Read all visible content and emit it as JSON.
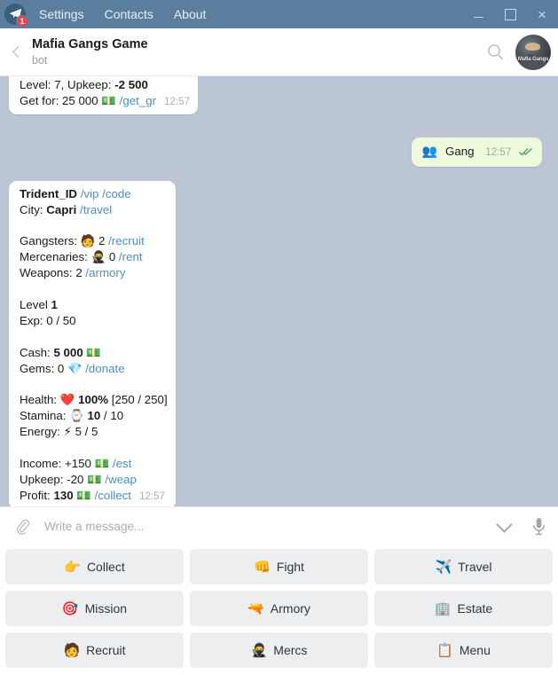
{
  "titlebar": {
    "logo_icon": "telegram-plane-icon",
    "unread_badge": "1",
    "menu": [
      {
        "label": "Settings"
      },
      {
        "label": "Contacts"
      },
      {
        "label": "About"
      }
    ],
    "window_controls": {
      "minimize": "minimize-icon",
      "maximize": "maximize-icon",
      "close": "×"
    },
    "bg_color": "#5b7e9e"
  },
  "chat_header": {
    "back_icon": "chevron-left-icon",
    "title": "Mafia Gangs Game",
    "subtitle": "bot",
    "search_icon": "search-icon",
    "avatar_text": "Mafia Gangs"
  },
  "chat": {
    "bg_color": "#bcc5d4",
    "messages": [
      {
        "id": "msg-partial-top",
        "direction": "in",
        "partial": true,
        "lines": [
          {
            "segments": [
              {
                "t": "Level: 7, Upkeep: ",
                "s": "plain"
              },
              {
                "t": "-2 500",
                "s": "bold"
              }
            ]
          },
          {
            "segments": [
              {
                "t": "Get for: 25 000 ",
                "s": "plain"
              },
              {
                "t": "💵",
                "s": "emoji"
              },
              {
                "t": " ",
                "s": "plain"
              },
              {
                "t": "/get_gr",
                "s": "cmd"
              }
            ]
          }
        ],
        "time": "12:57"
      },
      {
        "id": "msg-gang-out",
        "direction": "out",
        "text": "Gang",
        "icon": "👥",
        "time": "12:57",
        "status": "read",
        "bubble_color": "#effadd"
      },
      {
        "id": "msg-profile-in",
        "direction": "in",
        "blocks": [
          {
            "block": "identity",
            "lines": [
              {
                "segments": [
                  {
                    "t": "Trident_ID",
                    "s": "bold"
                  },
                  {
                    "t": " ",
                    "s": "plain"
                  },
                  {
                    "t": "/vip",
                    "s": "cmd"
                  },
                  {
                    "t": " ",
                    "s": "plain"
                  },
                  {
                    "t": "/code",
                    "s": "cmd"
                  }
                ]
              },
              {
                "segments": [
                  {
                    "t": "City: ",
                    "s": "plain"
                  },
                  {
                    "t": "Capri",
                    "s": "bold"
                  },
                  {
                    "t": " ",
                    "s": "plain"
                  },
                  {
                    "t": "/travel",
                    "s": "cmd"
                  }
                ]
              }
            ]
          },
          {
            "block": "units",
            "lines": [
              {
                "segments": [
                  {
                    "t": "Gangsters: ",
                    "s": "plain"
                  },
                  {
                    "t": "🧑",
                    "s": "emoji"
                  },
                  {
                    "t": " 2 ",
                    "s": "plain"
                  },
                  {
                    "t": "/recruit",
                    "s": "cmd"
                  }
                ]
              },
              {
                "segments": [
                  {
                    "t": "Mercenaries: ",
                    "s": "plain"
                  },
                  {
                    "t": "🥷",
                    "s": "emoji"
                  },
                  {
                    "t": " 0 ",
                    "s": "plain"
                  },
                  {
                    "t": "/rent",
                    "s": "cmd"
                  }
                ]
              },
              {
                "segments": [
                  {
                    "t": "Weapons: 2 ",
                    "s": "plain"
                  },
                  {
                    "t": "/armory",
                    "s": "cmd"
                  }
                ]
              }
            ]
          },
          {
            "block": "level",
            "lines": [
              {
                "segments": [
                  {
                    "t": "Level ",
                    "s": "plain"
                  },
                  {
                    "t": "1",
                    "s": "bold"
                  }
                ]
              },
              {
                "segments": [
                  {
                    "t": "Exp: 0 / 50",
                    "s": "plain"
                  }
                ]
              }
            ]
          },
          {
            "block": "currency",
            "lines": [
              {
                "segments": [
                  {
                    "t": "Cash: ",
                    "s": "plain"
                  },
                  {
                    "t": "5 000",
                    "s": "bold"
                  },
                  {
                    "t": " ",
                    "s": "plain"
                  },
                  {
                    "t": "💵",
                    "s": "emoji"
                  }
                ]
              },
              {
                "segments": [
                  {
                    "t": "Gems: 0 ",
                    "s": "plain"
                  },
                  {
                    "t": "💎",
                    "s": "emoji"
                  },
                  {
                    "t": " ",
                    "s": "plain"
                  },
                  {
                    "t": "/donate",
                    "s": "cmd"
                  }
                ]
              }
            ]
          },
          {
            "block": "vitals",
            "lines": [
              {
                "segments": [
                  {
                    "t": "Health: ",
                    "s": "plain"
                  },
                  {
                    "t": "❤️",
                    "s": "emoji"
                  },
                  {
                    "t": " ",
                    "s": "plain"
                  },
                  {
                    "t": "100%",
                    "s": "bold"
                  },
                  {
                    "t": " [250 / 250]",
                    "s": "plain"
                  }
                ]
              },
              {
                "segments": [
                  {
                    "t": "Stamina: ",
                    "s": "plain"
                  },
                  {
                    "t": "⌚",
                    "s": "emoji"
                  },
                  {
                    "t": " ",
                    "s": "plain"
                  },
                  {
                    "t": "10",
                    "s": "bold"
                  },
                  {
                    "t": " / 10",
                    "s": "plain"
                  }
                ]
              },
              {
                "segments": [
                  {
                    "t": "Energy: ",
                    "s": "plain"
                  },
                  {
                    "t": "⚡",
                    "s": "emoji"
                  },
                  {
                    "t": " 5 / 5",
                    "s": "plain"
                  }
                ]
              }
            ]
          },
          {
            "block": "economy",
            "lines": [
              {
                "segments": [
                  {
                    "t": "Income: +150 ",
                    "s": "plain"
                  },
                  {
                    "t": "💵",
                    "s": "emoji"
                  },
                  {
                    "t": " ",
                    "s": "plain"
                  },
                  {
                    "t": "/est",
                    "s": "cmd"
                  }
                ]
              },
              {
                "segments": [
                  {
                    "t": "Upkeep: -20 ",
                    "s": "plain"
                  },
                  {
                    "t": "💵",
                    "s": "emoji"
                  },
                  {
                    "t": " ",
                    "s": "plain"
                  },
                  {
                    "t": "/weap",
                    "s": "cmd"
                  }
                ]
              },
              {
                "segments": [
                  {
                    "t": "Profit: ",
                    "s": "plain"
                  },
                  {
                    "t": "130",
                    "s": "bold"
                  },
                  {
                    "t": " ",
                    "s": "plain"
                  },
                  {
                    "t": "💵",
                    "s": "emoji"
                  },
                  {
                    "t": " ",
                    "s": "plain"
                  },
                  {
                    "t": "/collect",
                    "s": "cmd"
                  }
                ]
              }
            ]
          }
        ],
        "time": "12:57"
      }
    ]
  },
  "composer": {
    "attach_icon": "paperclip-icon",
    "placeholder": "Write a message...",
    "value": "",
    "collapse_icon": "chevron-down-icon",
    "mic_icon": "microphone-icon"
  },
  "bot_keyboard": {
    "rows": [
      [
        {
          "icon": "👉",
          "label": "Collect",
          "name": "collect"
        },
        {
          "icon": "👊",
          "label": "Fight",
          "name": "fight"
        },
        {
          "icon": "✈️",
          "label": "Travel",
          "name": "travel"
        }
      ],
      [
        {
          "icon": "🎯",
          "label": "Mission",
          "name": "mission"
        },
        {
          "icon": "🔫",
          "label": "Armory",
          "name": "armory"
        },
        {
          "icon": "🏢",
          "label": "Estate",
          "name": "estate"
        }
      ],
      [
        {
          "icon": "🧑",
          "label": "Recruit",
          "name": "recruit"
        },
        {
          "icon": "🥷",
          "label": "Mercs",
          "name": "mercs"
        },
        {
          "icon": "📋",
          "label": "Menu",
          "name": "menu"
        }
      ]
    ]
  }
}
